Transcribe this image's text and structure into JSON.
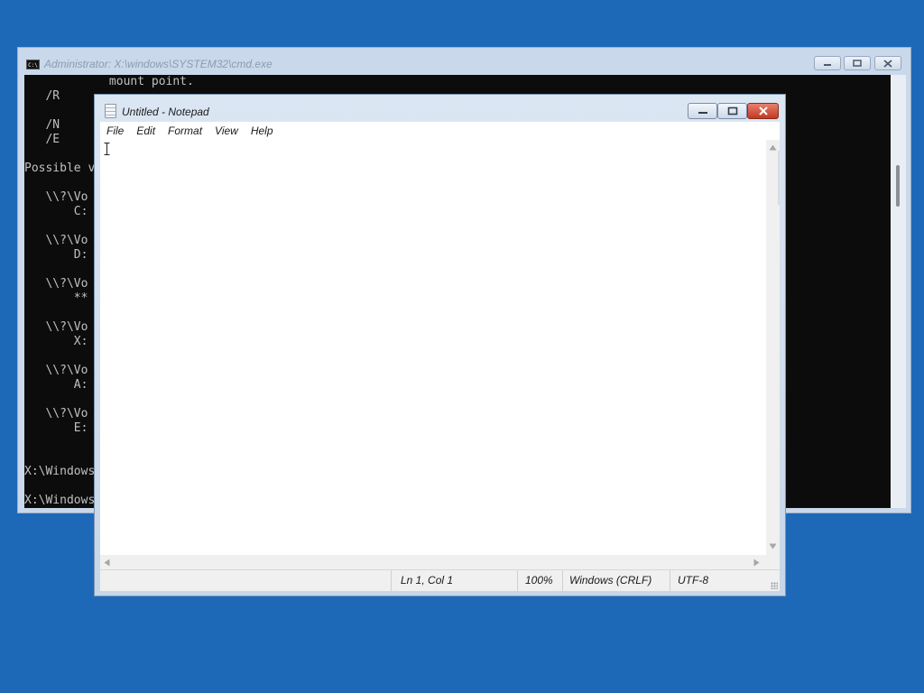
{
  "desktop": {
    "background_color": "#1e68b8"
  },
  "cmd": {
    "title": "Administrator: X:\\windows\\SYSTEM32\\cmd.exe",
    "icon": "C:\\",
    "lines": [
      "            mount point.",
      "   /R",
      "",
      "   /N",
      "   /E",
      "",
      "Possible v",
      "",
      "   \\\\?\\Vo",
      "       C:",
      "",
      "   \\\\?\\Vo",
      "       D:",
      "",
      "   \\\\?\\Vo",
      "       **",
      "",
      "   \\\\?\\Vo",
      "       X:",
      "",
      "   \\\\?\\Vo",
      "       A:",
      "",
      "   \\\\?\\Vo",
      "       E:",
      "",
      "",
      "X:\\Windows",
      "",
      "X:\\Windows"
    ],
    "buttons": {
      "minimize": "minimize-icon",
      "maximize": "maximize-icon",
      "close": "close-icon"
    }
  },
  "notepad": {
    "title": "Untitled - Notepad",
    "menu": [
      "File",
      "Edit",
      "Format",
      "View",
      "Help"
    ],
    "content": "",
    "status": {
      "position": "Ln 1, Col 1",
      "zoom": "100%",
      "line_ending": "Windows (CRLF)",
      "encoding": "UTF-8"
    },
    "colors": {
      "close_button": "#c23a22"
    }
  }
}
